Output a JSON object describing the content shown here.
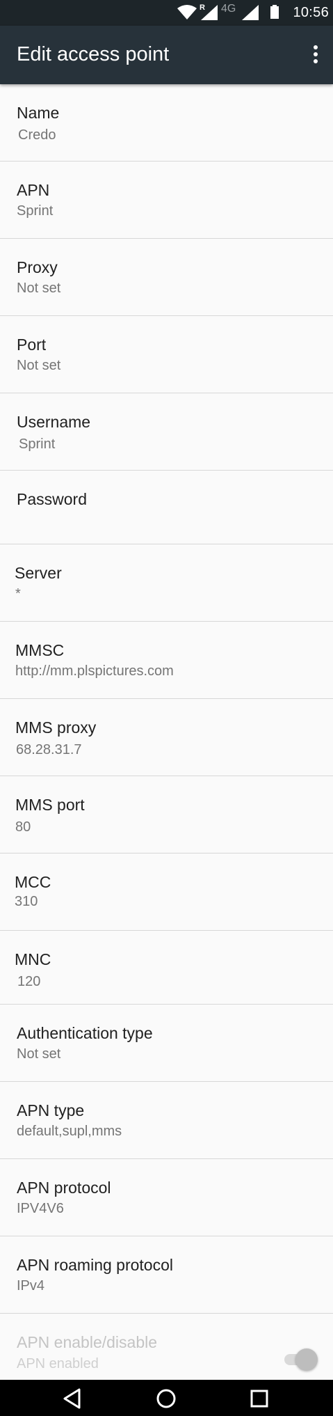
{
  "status_bar": {
    "time": "10:56",
    "roaming_indicator": "R",
    "network_type": "4G",
    "icons": [
      "wifi-icon",
      "signal-icon",
      "signal-icon",
      "battery-icon"
    ]
  },
  "app_bar": {
    "title": "Edit access point",
    "menu_icon": "more-vert-icon"
  },
  "fields": [
    {
      "label": "Name",
      "value": "Credo"
    },
    {
      "label": "APN",
      "value": "Sprint"
    },
    {
      "label": "Proxy",
      "value": "Not set"
    },
    {
      "label": "Port",
      "value": "Not set"
    },
    {
      "label": "Username",
      "value": "Sprint"
    },
    {
      "label": "Password",
      "value": ""
    },
    {
      "label": "Server",
      "value": "*"
    },
    {
      "label": "MMSC",
      "value": "http://mm.plspictures.com"
    },
    {
      "label": "MMS proxy",
      "value": "68.28.31.7"
    },
    {
      "label": "MMS port",
      "value": "80"
    },
    {
      "label": "MCC",
      "value": "310"
    },
    {
      "label": "MNC",
      "value": "120"
    },
    {
      "label": "Authentication type",
      "value": "Not set"
    },
    {
      "label": "APN type",
      "value": "default,supl,mms"
    },
    {
      "label": "APN protocol",
      "value": "IPV4V6"
    },
    {
      "label": "APN roaming protocol",
      "value": "IPv4"
    },
    {
      "label": "APN enable/disable",
      "value": "APN enabled",
      "toggle_on": true,
      "disabled": true
    }
  ],
  "nav_bar": {
    "icons": [
      "back-icon",
      "home-icon",
      "recents-icon"
    ]
  },
  "colors": {
    "status_bar_bg": "#1d2529",
    "app_bar_bg": "#27323a",
    "background": "#fafafa",
    "divider": "#d7d7d7",
    "label_text": "#212121",
    "value_text": "#757575"
  }
}
